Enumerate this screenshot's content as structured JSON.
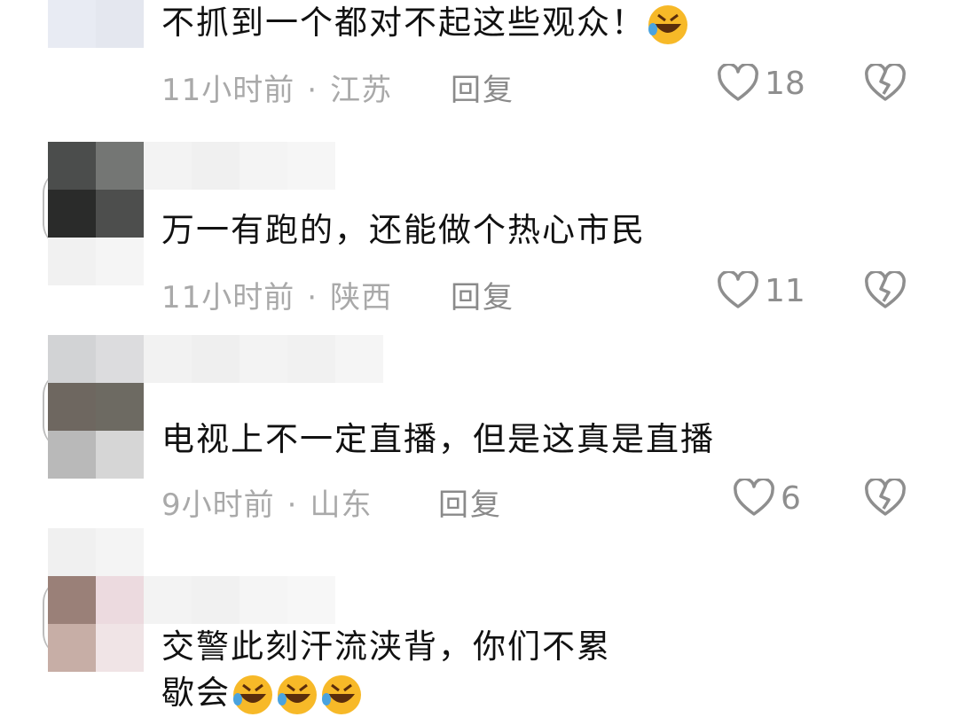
{
  "comments": [
    {
      "text": "不抓到一个都对不起这些观众！",
      "time": "11小时前",
      "separator": "·",
      "location": "江苏",
      "reply_label": "回复",
      "likes": "18",
      "emojis": [
        "rofl-emoji"
      ]
    },
    {
      "text": "万一有跑的，还能做个热心市民",
      "time": "11小时前",
      "separator": "·",
      "location": "陕西",
      "reply_label": "回复",
      "likes": "11",
      "emojis": []
    },
    {
      "text": "电视上不一定直播，但是这真是直播",
      "time": "9小时前",
      "separator": "·",
      "location": "山东",
      "reply_label": "回复",
      "likes": "6",
      "emojis": []
    },
    {
      "text_line1": "交警此刻汗流浃背，你们不累",
      "text_line2": "歇会",
      "emojis": [
        "rofl-emoji",
        "rofl-emoji",
        "rofl-emoji"
      ]
    }
  ],
  "icons": {
    "like": "heart-outline-icon",
    "dislike": "broken-heart-icon",
    "emoji": "rolling-on-floor-laughing-emoji"
  },
  "colors": {
    "text": "#111111",
    "meta": "#a9a9a9",
    "icon": "#8e8e8e",
    "emoji_face": "#f7b928"
  }
}
